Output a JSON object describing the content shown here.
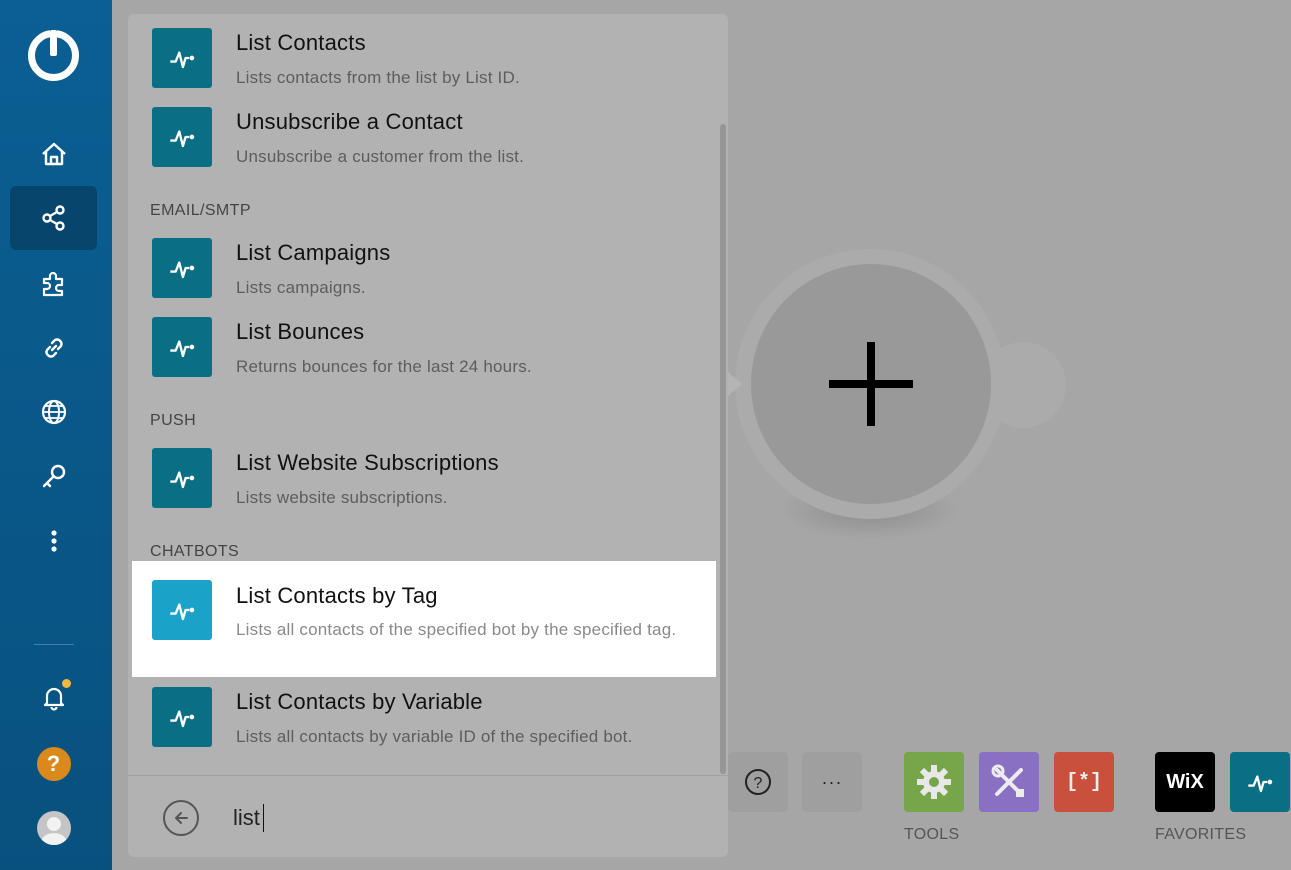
{
  "sidebar": {
    "items": [
      {
        "name": "home",
        "icon": "home-icon"
      },
      {
        "name": "scenarios",
        "icon": "share-nodes-icon",
        "active": true
      },
      {
        "name": "templates",
        "icon": "puzzle-icon"
      },
      {
        "name": "connections",
        "icon": "link-icon"
      },
      {
        "name": "webhooks",
        "icon": "globe-icon"
      },
      {
        "name": "keys",
        "icon": "key-icon"
      },
      {
        "name": "more",
        "icon": "more-vertical-icon"
      }
    ],
    "help_label": "?"
  },
  "panel": {
    "items": [
      {
        "title": "List Contacts",
        "desc": "Lists contacts from the list by List ID."
      },
      {
        "title": "Unsubscribe a Contact",
        "desc": "Unsubscribe a customer from the list."
      },
      {
        "title": "List Campaigns",
        "desc": "Lists campaigns."
      },
      {
        "title": "List Bounces",
        "desc": "Returns bounces for the last 24 hours."
      },
      {
        "title": "List Website Subscriptions",
        "desc": "Lists website subscriptions."
      },
      {
        "title": "List Contacts by Tag",
        "desc": "Lists all contacts of the specified bot by the specified tag."
      },
      {
        "title": "List Contacts by Variable",
        "desc": "Lists all contacts by variable ID of the specified bot."
      }
    ],
    "sections": {
      "email": "EMAIL/SMTP",
      "push": "PUSH",
      "chatbots": "CHATBOTS"
    },
    "search": {
      "value": "list"
    }
  },
  "toolbar": {
    "help_label": "?",
    "more_label": "···",
    "tools_label": "TOOLS",
    "favorites_label": "FAVORITES",
    "wix_label": "WiX",
    "bracket_label": "[*]",
    "colors": {
      "tools_green": "#77a64a",
      "tools_purple": "#8a70c2",
      "tools_red": "#c9503d",
      "wix_bg": "#000000",
      "app_teal": "#0a6e85"
    }
  }
}
